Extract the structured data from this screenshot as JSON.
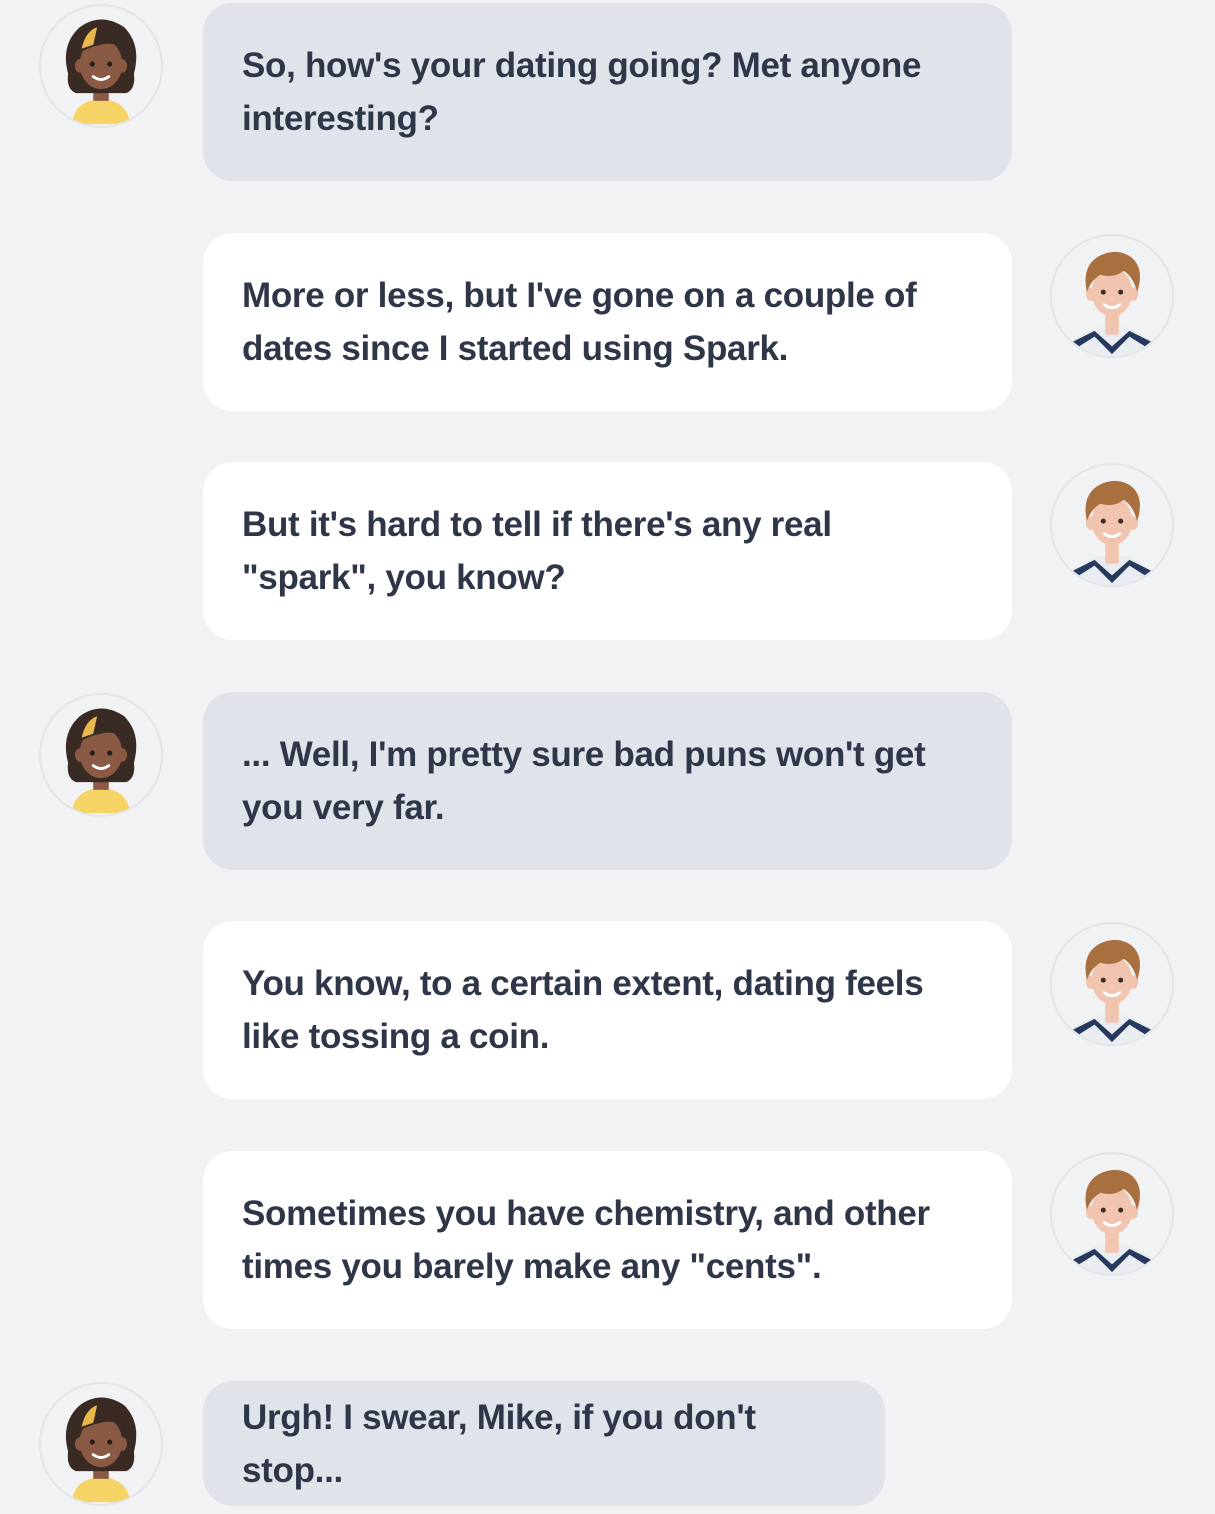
{
  "conversation": {
    "participants": {
      "friend": {
        "avatar_icon": "woman-avatar-icon",
        "side": "left"
      },
      "mike": {
        "avatar_icon": "man-avatar-icon",
        "side": "right"
      }
    },
    "messages": [
      {
        "from": "friend",
        "text": "So, how's your dating going? Met anyone interesting?"
      },
      {
        "from": "mike",
        "text": "More or less, but I've gone on a couple of dates since I started using Spark."
      },
      {
        "from": "mike",
        "text": "But it's hard to tell if there's any real \"spark\", you know?"
      },
      {
        "from": "friend",
        "text": "... Well, I'm pretty sure bad puns won't get you very far."
      },
      {
        "from": "mike",
        "text": "You know, to a certain extent, dating feels like tossing a coin."
      },
      {
        "from": "mike",
        "text": "Sometimes you have chemistry, and other times you barely make any \"cents\"."
      },
      {
        "from": "friend",
        "text": "Urgh! I swear, Mike, if you don't stop..."
      }
    ]
  },
  "colors": {
    "background": "#f1f2f4",
    "friend_bubble": "#e0e4ea",
    "mike_bubble": "#ffffff",
    "text": "#2e3648"
  }
}
